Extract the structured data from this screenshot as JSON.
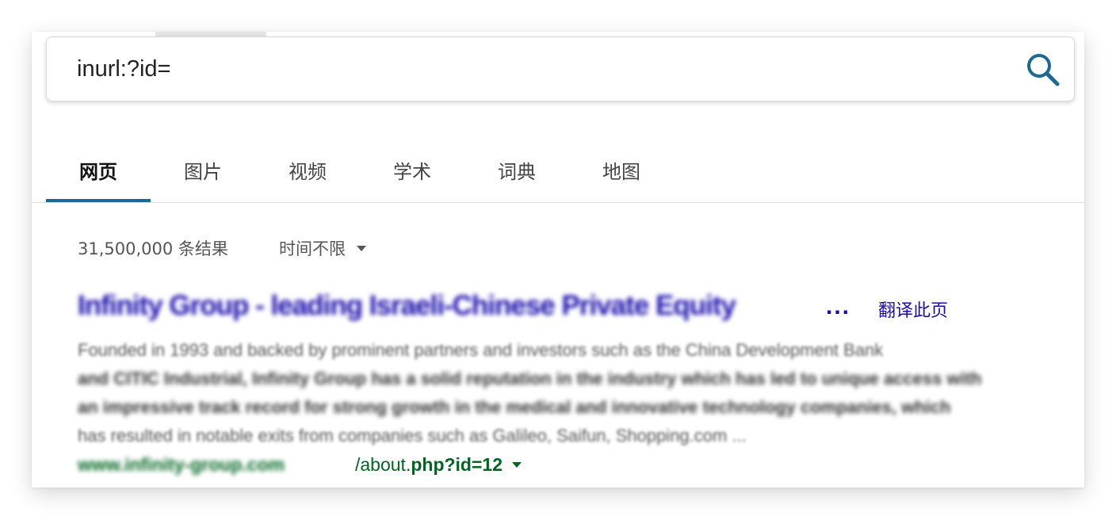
{
  "search": {
    "query": "inurl:?id="
  },
  "icons": {
    "search": "search-icon",
    "time_filter_dropdown": "caret-down-icon",
    "url_options": "caret-down-icon"
  },
  "colors": {
    "accent": "#1a6a94",
    "link": "#1a0dab",
    "url": "#006621",
    "muted_text": "#555555"
  },
  "tabs": [
    {
      "label": "网页",
      "active": true
    },
    {
      "label": "图片",
      "active": false
    },
    {
      "label": "视频",
      "active": false
    },
    {
      "label": "学术",
      "active": false
    },
    {
      "label": "词典",
      "active": false
    },
    {
      "label": "地图",
      "active": false
    }
  ],
  "results_meta": {
    "count": "31,500,000 条结果",
    "time_filter": "时间不限"
  },
  "result": {
    "title": "Infinity Group - leading Israeli-Chinese Private Equity",
    "title_ellipsis": "...",
    "translate": "翻译此页",
    "snippet_lines": [
      "Founded in 1993 and backed by prominent partners and investors such as the China Development Bank",
      "and CITIC Industrial, Infinity Group has a solid reputation in the industry which has led to unique access with",
      "an impressive track record for strong growth in the medical and innovative technology companies, which",
      "has resulted in notable exits from companies such as Galileo, Saifun, Shopping.com ..."
    ],
    "url_domain": "www.infinity-group.com",
    "url_path_prefix": "/about.",
    "url_path_bold": "php?id=12"
  }
}
